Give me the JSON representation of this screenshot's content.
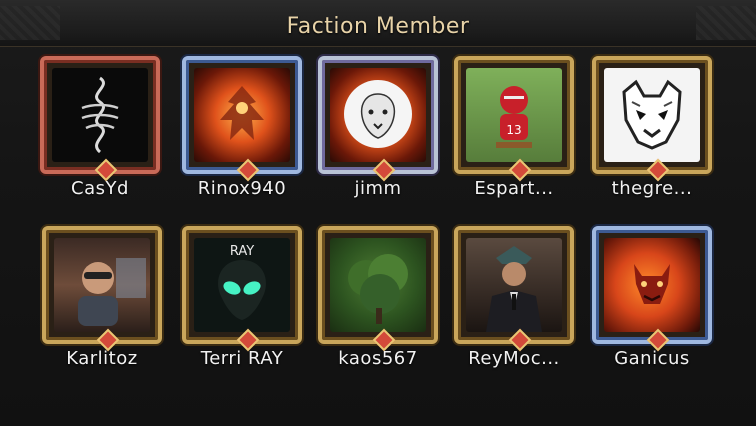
{
  "window": {
    "title": "Faction Member"
  },
  "members": [
    {
      "name": "CasYd",
      "avatar_icon": "serpent-glyph-icon",
      "frame": "red"
    },
    {
      "name": "Rinox940",
      "avatar_icon": "fire-dragon-icon",
      "frame": "blue"
    },
    {
      "name": "jimm",
      "avatar_icon": "lion-icon",
      "frame": "silver"
    },
    {
      "name": "Espart...",
      "avatar_icon": "football-player-icon",
      "frame": "gold"
    },
    {
      "name": "thegre...",
      "avatar_icon": "panda-tiger-icon",
      "frame": "gold"
    },
    {
      "name": "Karlitoz",
      "avatar_icon": "driver-selfie-icon",
      "frame": "gold"
    },
    {
      "name": "Terri RAY",
      "avatar_icon": "alien-icon",
      "avatar_text": "RAY",
      "frame": "gold"
    },
    {
      "name": "kaos567",
      "avatar_icon": "tree-icon",
      "frame": "gold"
    },
    {
      "name": "ReyMoc...",
      "avatar_icon": "suited-man-icon",
      "frame": "gold"
    },
    {
      "name": "Ganicus",
      "avatar_icon": "demon-face-icon",
      "frame": "blue"
    }
  ],
  "colors": {
    "title": "#e8d3a8",
    "name": "#f2f2f2",
    "background": "#131313",
    "frame_gold": "#c9a65b"
  }
}
